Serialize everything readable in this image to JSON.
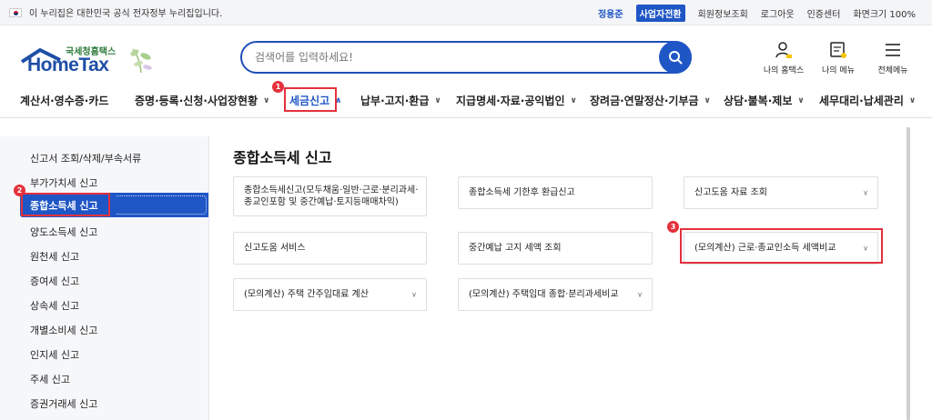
{
  "topbar": {
    "gov_notice": "이 누리집은 대한민국 공식 전자정부 누리집입니다.",
    "user_name": "정용준",
    "business_switch": "사업자전환",
    "links": [
      "회원정보조회",
      "로그아웃",
      "인증센터",
      "화면크기 100%"
    ]
  },
  "header": {
    "logo_sub": "국세청홈택스",
    "logo_main": "HomeTax",
    "search_placeholder": "검색어를 입력하세요!",
    "icons": [
      {
        "label": "나의 홈택스",
        "icon": "my-hometax-icon"
      },
      {
        "label": "나의 메뉴",
        "icon": "my-menu-icon"
      },
      {
        "label": "전체메뉴",
        "icon": "hamburger-icon"
      }
    ]
  },
  "gnb": {
    "items": [
      {
        "label": "계산서·영수증·카드"
      },
      {
        "label": "증명·등록·신청·사업장현황"
      },
      {
        "label": "세금신고"
      },
      {
        "label": "납부·고지·환급"
      },
      {
        "label": "지급명세·자료·공익법인"
      },
      {
        "label": "장려금·연말정산·기부금"
      },
      {
        "label": "상담·불복·제보"
      },
      {
        "label": "세무대리·납세관리"
      }
    ],
    "active_index": 2
  },
  "annotations": {
    "step1": "1",
    "step2": "2",
    "step3": "3"
  },
  "sidebar": {
    "items": [
      {
        "label": "신고서 조회/삭제/부속서류"
      },
      {
        "label": "부가가치세 신고"
      },
      {
        "label": "종합소득세 신고"
      },
      {
        "label": "양도소득세 신고"
      },
      {
        "label": "원천세 신고"
      },
      {
        "label": "증여세 신고"
      },
      {
        "label": "상속세 신고"
      },
      {
        "label": "개별소비세 신고"
      },
      {
        "label": "인지세 신고"
      },
      {
        "label": "주세 신고"
      },
      {
        "label": "증권거래세 신고"
      }
    ],
    "active_index": 2
  },
  "content": {
    "title": "종합소득세 신고",
    "cards": [
      {
        "label": "종합소득세신고(모두채움·일반·근로·분리과세·종교인포함 및 중간예납·토지등매매차익)"
      },
      {
        "label": "종합소득세 기한후 환급신고"
      },
      {
        "label": "신고도움 자료 조회"
      },
      {
        "label": "신고도움 서비스"
      },
      {
        "label": "중간예납 고지 세액 조회"
      },
      {
        "label": "(모의계산) 근로·종교인소득 세액비교"
      },
      {
        "label": "(모의계산) 주택 간주임대료 계산"
      },
      {
        "label": "(모의계산) 주택임대 종합·분리과세비교"
      }
    ]
  },
  "colors": {
    "primary": "#1f56c6",
    "highlight": "#e4313c"
  }
}
